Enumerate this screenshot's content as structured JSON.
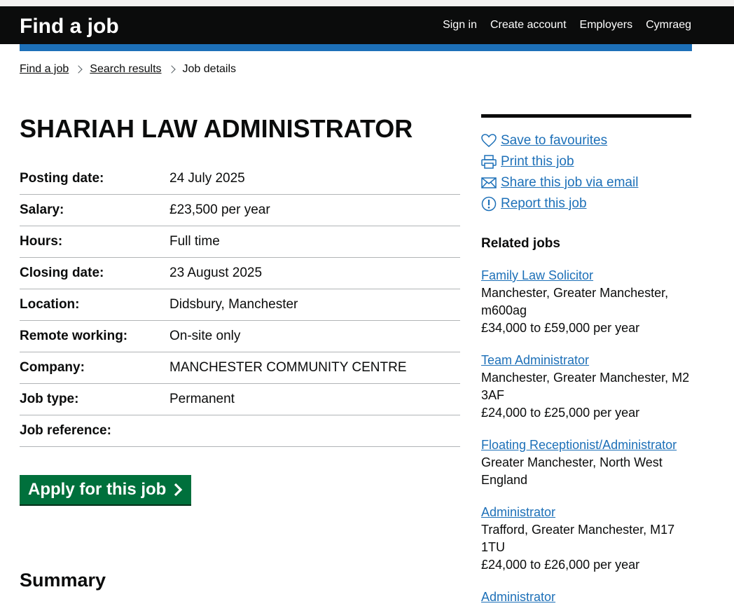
{
  "header": {
    "logo": "Find a job",
    "nav": [
      "Sign in",
      "Create account",
      "Employers",
      "Cymraeg"
    ]
  },
  "breadcrumb": {
    "items": [
      "Find a job",
      "Search results"
    ],
    "current": "Job details"
  },
  "job": {
    "title": "SHARIAH LAW ADMINISTRATOR",
    "details": [
      {
        "label": "Posting date:",
        "value": "24 July 2025"
      },
      {
        "label": "Salary:",
        "value": "£23,500 per year"
      },
      {
        "label": "Hours:",
        "value": "Full time"
      },
      {
        "label": "Closing date:",
        "value": "23 August 2025"
      },
      {
        "label": "Location:",
        "value": "Didsbury, Manchester"
      },
      {
        "label": "Remote working:",
        "value": "On-site only"
      },
      {
        "label": "Company:",
        "value": "MANCHESTER COMMUNITY CENTRE"
      },
      {
        "label": "Job type:",
        "value": "Permanent"
      },
      {
        "label": "Job reference:",
        "value": ""
      }
    ],
    "apply_label": "Apply for this job",
    "summary_heading": "Summary"
  },
  "sidebar": {
    "actions": [
      {
        "label": "Save to favourites",
        "icon": "heart-icon"
      },
      {
        "label": "Print this job",
        "icon": "printer-icon"
      },
      {
        "label": "Share this job via email",
        "icon": "envelope-icon"
      },
      {
        "label": "Report this job",
        "icon": "alert-icon"
      }
    ],
    "related_heading": "Related jobs",
    "related": [
      {
        "title": "Family Law Solicitor",
        "location": "Manchester, Greater Manchester, m600ag",
        "salary": "£34,000 to £59,000 per year"
      },
      {
        "title": "Team Administrator",
        "location": "Manchester, Greater Manchester, M2 3AF",
        "salary": "£24,000 to £25,000 per year"
      },
      {
        "title": "Floating Receptionist/Administrator",
        "location": "Greater Manchester, North West England",
        "salary": ""
      },
      {
        "title": "Administrator",
        "location": "Trafford, Greater Manchester, M17 1TU",
        "salary": "£24,000 to £26,000 per year"
      },
      {
        "title": "Administrator",
        "location": "",
        "salary": ""
      }
    ]
  },
  "colors": {
    "header_bg": "#0b0c0c",
    "accent_blue": "#1d70b8",
    "apply_green": "#00703c"
  }
}
